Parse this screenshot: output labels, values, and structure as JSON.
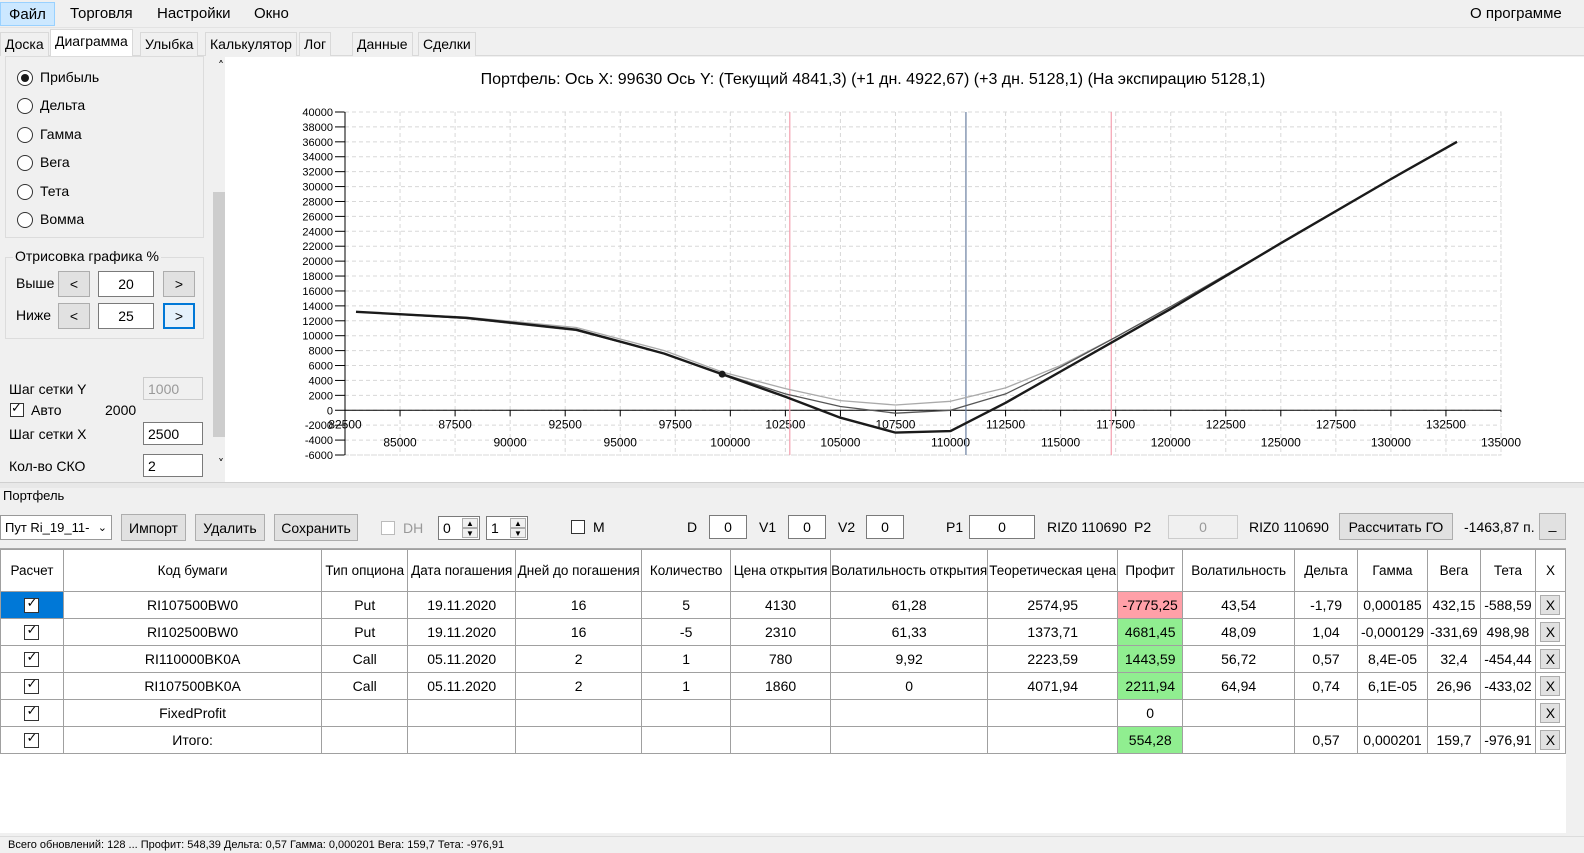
{
  "menu": {
    "file": "Файл",
    "trade": "Торговля",
    "settings": "Настройки",
    "window": "Окно",
    "about": "О программе"
  },
  "tabs": [
    "Доска",
    "Диаграмма",
    "Улыбка",
    "Калькулятор",
    "Лог",
    "Данные",
    "Сделки"
  ],
  "left_panel": {
    "radios": [
      "Прибыль",
      "Дельта",
      "Гамма",
      "Вега",
      "Тета",
      "Вомма"
    ],
    "selected_radio": "Прибыль",
    "draw_group_title": "Отрисовка графика %",
    "above_label": "Выше",
    "above_value": "20",
    "below_label": "Ниже",
    "below_value": "25",
    "btn_less": "<",
    "btn_more": ">",
    "grid_y_label": "Шаг сетки Y",
    "grid_y_value": "1000",
    "auto_label": "Авто",
    "auto_value": "2000",
    "grid_x_label": "Шаг сетки X",
    "grid_x_value": "2500",
    "sko_label": "Кол-во СКО",
    "sko_value": "2"
  },
  "chart_data": {
    "type": "line",
    "title": "Портфель: Ось X: 99630 Ось Y:  (Текущий 4841,3)  (+1 дн. 4922,67)  (+3 дн. 5128,1)  (На экспирацию 5128,1)",
    "xlim": [
      82500,
      135000
    ],
    "ylim": [
      -6000,
      40000
    ],
    "x_ticks_upper": [
      "82500",
      "87500",
      "92500",
      "97500",
      "102500",
      "107500",
      "112500",
      "117500",
      "122500",
      "127500",
      "132500"
    ],
    "x_ticks_lower": [
      "85000",
      "90000",
      "95000",
      "100000",
      "105000",
      "110000",
      "115000",
      "120000",
      "125000",
      "130000",
      "135000"
    ],
    "y_ticks": [
      "40000",
      "38000",
      "36000",
      "34000",
      "32000",
      "30000",
      "28000",
      "26000",
      "24000",
      "22000",
      "20000",
      "18000",
      "16000",
      "14000",
      "12000",
      "10000",
      "8000",
      "6000",
      "4000",
      "2000",
      "0",
      "-2000",
      "-4000",
      "-6000"
    ],
    "grid": true,
    "vertical_lines": [
      {
        "x": 102700,
        "color": "#f4a0b0"
      },
      {
        "x": 110700,
        "color": "#6a7fa0"
      },
      {
        "x": 117300,
        "color": "#f4a0b0"
      }
    ],
    "marker": {
      "x": 99630,
      "y": 4841
    },
    "series": [
      {
        "color": "#1a1a1a",
        "x": [
          83000,
          88000,
          93000,
          97000,
          99630,
          102500,
          105000,
          107500,
          110000,
          112500,
          115000,
          117500,
          120000,
          125000,
          130000,
          133000
        ],
        "y": [
          13200,
          12400,
          10800,
          7600,
          4841,
          1800,
          -1000,
          -3000,
          -2800,
          1000,
          5200,
          9400,
          13600,
          22400,
          31000,
          36000
        ]
      },
      {
        "color": "#555555",
        "x": [
          83000,
          88000,
          93000,
          97000,
          99630,
          102500,
          105000,
          107500,
          110000,
          112500,
          115000,
          117500,
          120000,
          125000,
          130000,
          133000
        ],
        "y": [
          13200,
          12300,
          10700,
          7600,
          4922,
          2200,
          500,
          -400,
          0,
          2200,
          5800,
          9800,
          13900,
          22400,
          31000,
          36000
        ]
      },
      {
        "color": "#aaaaaa",
        "x": [
          83000,
          88000,
          93000,
          97000,
          99630,
          102500,
          105000,
          107500,
          110000,
          112500,
          115000,
          117500,
          120000
        ],
        "y": [
          13200,
          12500,
          11100,
          8000,
          5128,
          2900,
          1300,
          700,
          1200,
          3000,
          6000,
          9800,
          13900
        ]
      }
    ]
  },
  "portfolio": {
    "group_title": "Портфель",
    "combo_value": "Пут Ri_19_11-",
    "import_btn": "Импорт",
    "delete_btn": "Удалить",
    "save_btn": "Сохранить",
    "dh_label": "DH",
    "spin1": "0",
    "spin2": "1",
    "m_label": "M",
    "d_label": "D",
    "d_value": "0",
    "v1_label": "V1",
    "v1_value": "0",
    "v2_label": "V2",
    "v2_value": "0",
    "p1_label": "P1",
    "p1_value": "0",
    "riz1": "RIZ0 110690",
    "p2_label": "P2",
    "p2_value": "0",
    "riz2": "RIZ0 110690",
    "calc_btn": "Рассчитать ГО",
    "go_value": "-1463,87 п.",
    "extra_btn": "_"
  },
  "table": {
    "headers": [
      "Расчет",
      "Код бумаги",
      "Тип опциона",
      "Дата погашения",
      "Дней до погашения",
      "Количество",
      "Цена открытия",
      "Волатильность открытия",
      "Теоретическая цена",
      "Профит",
      "Волатильность",
      "Дельта",
      "Гамма",
      "Вега",
      "Тета",
      "X"
    ],
    "rows": [
      [
        "",
        "RI107500BW0",
        "Put",
        "19.11.2020",
        "16",
        "5",
        "4130",
        "61,28",
        "2574,95",
        "-7775,25",
        "43,54",
        "-1,79",
        "0,000185",
        "432,15",
        "-588,59",
        "X"
      ],
      [
        "",
        "RI102500BW0",
        "Put",
        "19.11.2020",
        "16",
        "-5",
        "2310",
        "61,33",
        "1373,71",
        "4681,45",
        "48,09",
        "1,04",
        "-0,000129",
        "-331,69",
        "498,98",
        "X"
      ],
      [
        "",
        "RI110000BK0A",
        "Call",
        "05.11.2020",
        "2",
        "1",
        "780",
        "9,92",
        "2223,59",
        "1443,59",
        "56,72",
        "0,57",
        "8,4E-05",
        "32,4",
        "-454,44",
        "X"
      ],
      [
        "",
        "RI107500BK0A",
        "Call",
        "05.11.2020",
        "2",
        "1",
        "1860",
        "0",
        "4071,94",
        "2211,94",
        "64,94",
        "0,74",
        "6,1E-05",
        "26,96",
        "-433,02",
        "X"
      ],
      [
        "",
        "FixedProfit",
        "",
        "",
        "",
        "",
        "",
        "",
        "",
        "0",
        "",
        "",
        "",
        "",
        "",
        "X"
      ],
      [
        "",
        "Итого:",
        "",
        "",
        "",
        "",
        "",
        "",
        "",
        "554,28",
        "",
        "0,57",
        "0,000201",
        "159,7",
        "-976,91",
        "X"
      ]
    ]
  },
  "statusbar": "Всего обновлений: 128 ... Профит: 548,39 Дельта: 0,57 Гамма: 0,000201 Вега: 159,7 Тета: -976,91"
}
